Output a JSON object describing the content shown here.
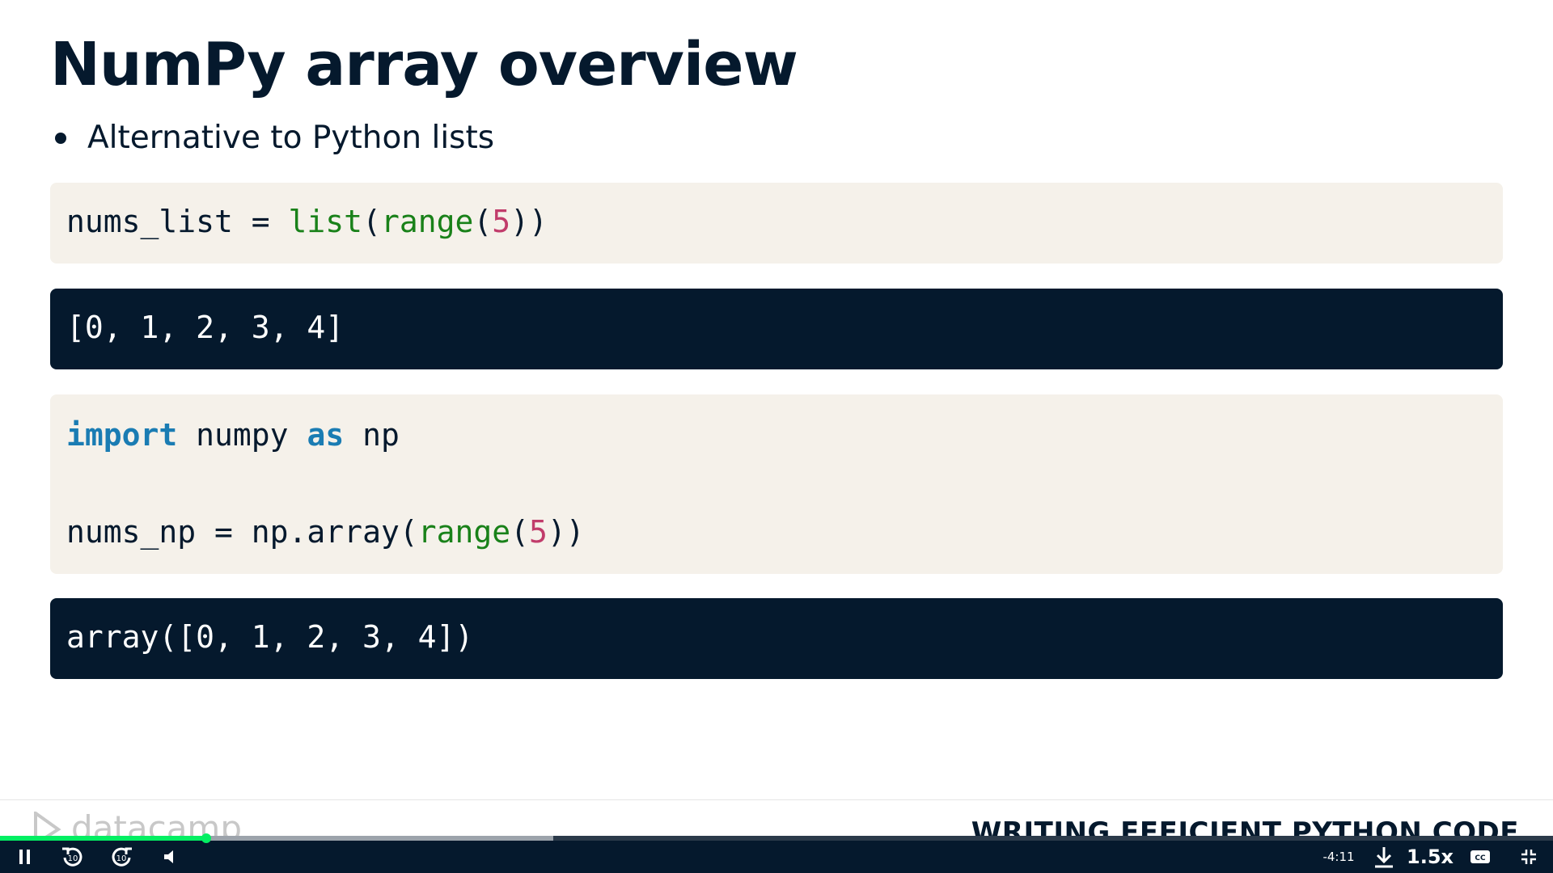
{
  "slide": {
    "title": "NumPy array overview",
    "bullet": "Alternative to Python lists"
  },
  "code": {
    "block1": {
      "var": "nums_list",
      "op": " = ",
      "fn1": "list",
      "p1": "(",
      "fn2": "range",
      "p2": "(",
      "num": "5",
      "p3": "))"
    },
    "output1": "[0, 1, 2, 3, 4]",
    "block2": {
      "kw1": "import",
      "mod": " numpy ",
      "kw2": "as",
      "alias": " np",
      "var": "nums_np",
      "op": " = ",
      "call": "np.array(",
      "fn": "range",
      "p1": "(",
      "num": "5",
      "p2": "))"
    },
    "output2": "array([0, 1, 2, 3, 4])"
  },
  "footer": {
    "logo_text": "datacamp",
    "course_name": "WRITING EFFICIENT PYTHON CODE"
  },
  "player": {
    "time_remaining": "-4:11",
    "speed": "1.5x",
    "progress_played": 0.133,
    "progress_buffered": 0.356,
    "icons": [
      "pause-icon",
      "rewind-10-icon",
      "forward-10-icon",
      "volume-icon",
      "download-icon",
      "captions-icon",
      "exit-fullscreen-icon"
    ]
  },
  "colors": {
    "navy": "#05192d",
    "code_bg": "#f5f1ea",
    "keyword": "#1a7cb3",
    "builtin": "#198119",
    "number": "#c13c6b",
    "progress": "#03ef62"
  }
}
